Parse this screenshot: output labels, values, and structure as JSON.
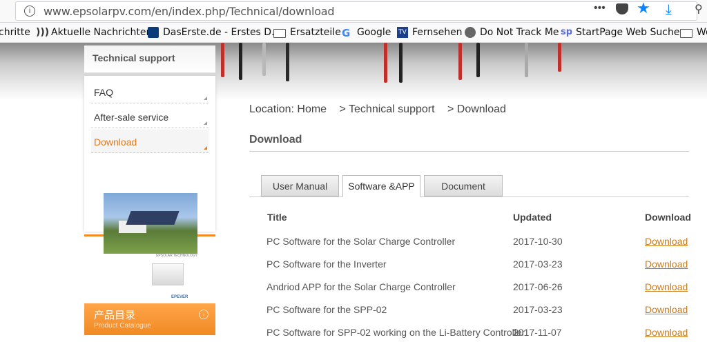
{
  "browser": {
    "url": "www.epsolarpv.com/en/index.php/Technical/download",
    "bookmarks": [
      {
        "label": "chritte",
        "icon": "none"
      },
      {
        "label": "Aktuelle Nachrichten",
        "icon": "rss-icon"
      },
      {
        "label": "DasErste.de - Erstes D...",
        "icon": "daserste-icon"
      },
      {
        "label": "Ersatzteile",
        "icon": "folder-icon"
      },
      {
        "label": "Google",
        "icon": "google-icon"
      },
      {
        "label": "Fernsehen",
        "icon": "tv-icon"
      },
      {
        "label": "Do Not Track Me",
        "icon": "globe-icon"
      },
      {
        "label": "StartPage Web Suchen",
        "icon": "startpage-icon"
      },
      {
        "label": "Wo",
        "icon": "folder-icon"
      }
    ]
  },
  "sidebar": {
    "heading": "Technical support",
    "items": [
      {
        "label": "FAQ",
        "active": false
      },
      {
        "label": "After-sale service",
        "active": false
      },
      {
        "label": "Download",
        "active": true
      }
    ],
    "promo_caption": "EPSOLAR TECHNOLOGY",
    "device_logo": "EPEVER",
    "catalog": {
      "title_cn": "产品目录",
      "title_en": "Product Catalogue"
    }
  },
  "breadcrumb": {
    "location": "Location: Home",
    "level1": "> Technical support",
    "level2": "> Download"
  },
  "main": {
    "title": "Download",
    "tabs": [
      {
        "label": "User Manual",
        "active": false
      },
      {
        "label": "Software &APP",
        "active": true
      },
      {
        "label": "Document",
        "active": false
      }
    ],
    "table": {
      "headers": [
        "Title",
        "Updated",
        "Download"
      ],
      "rows": [
        {
          "title": "PC Software for the Solar Charge Controller",
          "updated": "2017-10-30",
          "link": "Download"
        },
        {
          "title": "PC Software for the Inverter",
          "updated": "2017-03-23",
          "link": "Download"
        },
        {
          "title": "Andriod APP for the Solar Charge Controller",
          "updated": "2017-06-26",
          "link": "Download"
        },
        {
          "title": "PC Software for the SPP-02",
          "updated": "2017-03-23",
          "link": "Download"
        },
        {
          "title": "PC Software for SPP-02 working on the Li-Battery Controller",
          "updated": "2017-11-07",
          "link": "Download"
        }
      ]
    }
  },
  "colors": {
    "accent": "#e07a1f",
    "link": "#c97a1a",
    "star": "#0a84ff"
  }
}
